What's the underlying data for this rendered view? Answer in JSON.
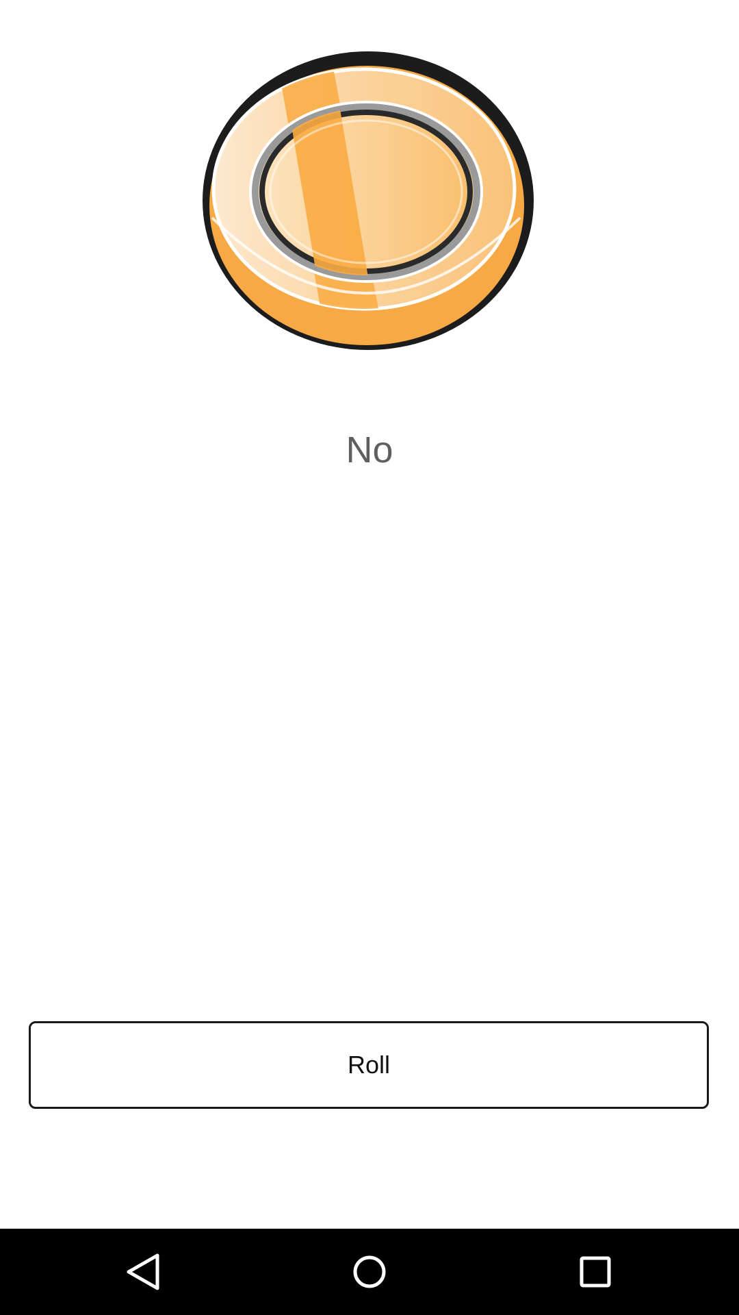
{
  "coin": {
    "icon": "coin-icon",
    "colors": {
      "gold": "#f9ab42",
      "outline": "#1c1c1c"
    }
  },
  "result": {
    "text": "No"
  },
  "roll_button": {
    "label": "Roll"
  },
  "nav_bar": {
    "background": "#000000",
    "buttons": [
      {
        "icon": "back-icon"
      },
      {
        "icon": "home-icon"
      },
      {
        "icon": "recents-icon"
      }
    ]
  }
}
